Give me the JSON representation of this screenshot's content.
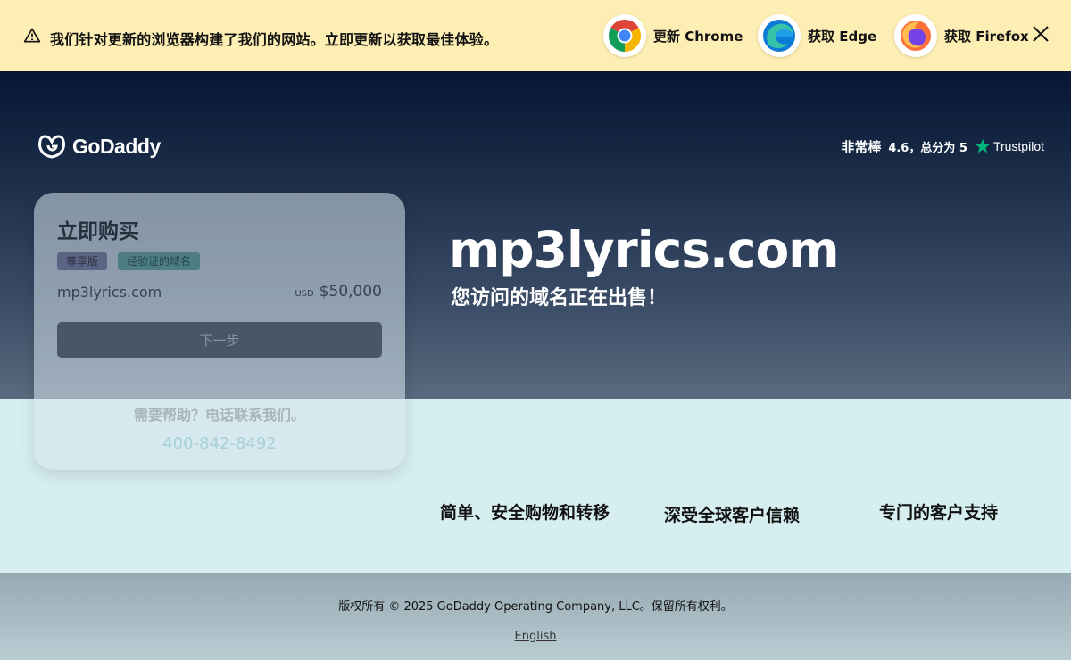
{
  "banner": {
    "message": "我们针对更新的浏览器构建了我们的网站。立即更新以获取最佳体验。",
    "browsers": [
      {
        "label": "更新 Chrome",
        "icon": "chrome-icon"
      },
      {
        "label": "获取 Edge",
        "icon": "edge-icon"
      },
      {
        "label": "获取 Firefox",
        "icon": "firefox-icon"
      }
    ],
    "close_icon": "close-icon",
    "warning_icon": "warning-icon"
  },
  "header": {
    "logo_text": "GoDaddy",
    "rating_word": "非常棒",
    "rating_score": "4.6，总分为 5",
    "rating_brand": "Trustpilot"
  },
  "hero": {
    "domain": "mp3lyrics.com",
    "subtitle": "您访问的域名正在出售！"
  },
  "card": {
    "title": "立即购买",
    "badge_premium": "尊享版",
    "badge_verified": "经验证的域名",
    "domain": "mp3lyrics.com",
    "currency": "USD",
    "price": "$50,000",
    "next_button": "下一步",
    "help_text": "需要帮助？电话联系我们。",
    "phone": "400-842-8492"
  },
  "features": [
    "简单、安全购物和转移",
    "深受全球客户信赖",
    "专门的客户支持"
  ],
  "footer": {
    "copyright": "版权所有 © 2025 GoDaddy Operating Company, LLC。保留所有权利。",
    "language": "English"
  },
  "colors": {
    "banner_bg": "#fdeeb3",
    "hero_top": "#061634",
    "features_bg": "#d6eef0",
    "trustpilot_star": "#00b67a"
  }
}
